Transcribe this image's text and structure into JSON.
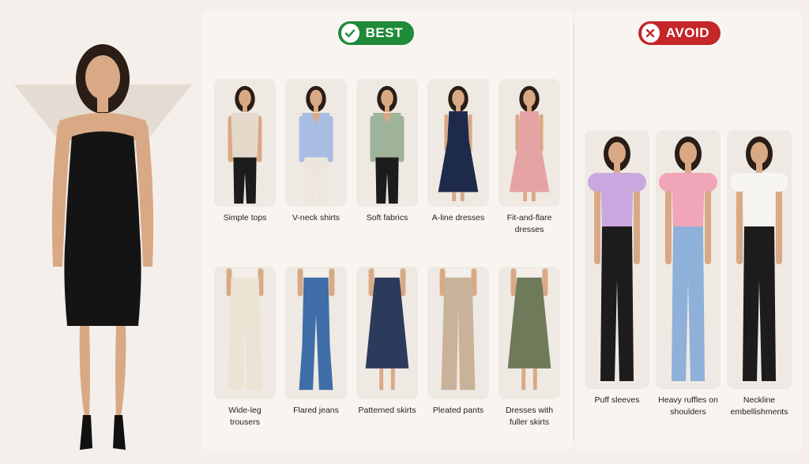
{
  "badges": {
    "best": "BEST",
    "avoid": "AVOID"
  },
  "best_row1": [
    {
      "label": "Simple tops",
      "top_color": "#e5d9cb",
      "bottom": "pants",
      "bottom_color": "#1c1c1c",
      "neck": "crew",
      "sleeve": "short"
    },
    {
      "label": "V-neck shirts",
      "top_color": "#a9bde3",
      "bottom": "pants",
      "bottom_color": "#ece6dc",
      "neck": "v",
      "sleeve": "long"
    },
    {
      "label": "Soft fabrics",
      "top_color": "#9fb39b",
      "bottom": "pants",
      "bottom_color": "#1c1c1c",
      "neck": "v",
      "sleeve": "long"
    },
    {
      "label": "A-line dresses",
      "top_color": "#1e2a4a",
      "bottom": "dress",
      "bottom_color": "#1e2a4a",
      "neck": "round",
      "sleeve": "none"
    },
    {
      "label": "Fit-and-flare dresses",
      "top_color": "#e6a3a3",
      "bottom": "dress",
      "bottom_color": "#e6a3a3",
      "neck": "v",
      "sleeve": "none"
    }
  ],
  "best_row2": [
    {
      "label": "Wide-leg trousers",
      "top_color": "#f4efe8",
      "bottom": "wide",
      "bottom_color": "#ece3d4"
    },
    {
      "label": "Flared jeans",
      "top_color": "#f4efe8",
      "bottom": "flare",
      "bottom_color": "#3f6ea8"
    },
    {
      "label": "Patterned skirts",
      "top_color": "#f4efe8",
      "bottom": "skirt",
      "bottom_color": "#2c3a5c"
    },
    {
      "label": "Pleated pants",
      "top_color": "#f4efe8",
      "bottom": "wide",
      "bottom_color": "#c9b29a"
    },
    {
      "label": "Dresses with fuller skirts",
      "top_color": "#f4efe8",
      "bottom": "skirt",
      "bottom_color": "#6e7a5a"
    }
  ],
  "avoid": [
    {
      "label": "Puff sleeves",
      "top_color": "#c9a8e0",
      "bottom_color": "#1c1c1c"
    },
    {
      "label": "Heavy ruffles on shoulders",
      "top_color": "#f0a5b8",
      "bottom_color": "#8fb0d8"
    },
    {
      "label": "Neckline embellishments",
      "top_color": "#f7f5f2",
      "bottom_color": "#1c1c1c"
    }
  ],
  "colors": {
    "best": "#1f8a3a",
    "avoid": "#c4262a",
    "skin": "#d9a985",
    "hair": "#2a1d16"
  }
}
